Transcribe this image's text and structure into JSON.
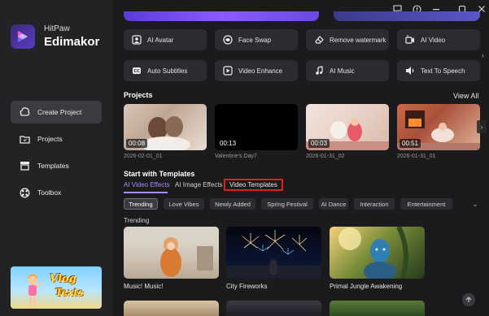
{
  "app": {
    "brand_small": "HitPaw",
    "brand_big": "Edimakor"
  },
  "sidebar": {
    "items": [
      {
        "label": "Create Project",
        "icon": "cloud-upload-icon",
        "active": true
      },
      {
        "label": "Projects",
        "icon": "folder-icon",
        "active": false
      },
      {
        "label": "Templates",
        "icon": "templates-icon",
        "active": false
      },
      {
        "label": "Toolbox",
        "icon": "toolbox-icon",
        "active": false
      }
    ],
    "banner": {
      "line1": "Vlog",
      "line2": "Texts"
    }
  },
  "window_controls": [
    "feedback-icon",
    "help-icon",
    "minimize-icon",
    "maximize-icon",
    "close-icon"
  ],
  "tools": [
    {
      "label": "AI Avatar",
      "icon": "avatar-icon"
    },
    {
      "label": "Face Swap",
      "icon": "face-swap-icon"
    },
    {
      "label": "Remove watermark",
      "icon": "eraser-icon"
    },
    {
      "label": "AI Video",
      "icon": "ai-video-icon"
    },
    {
      "label": "Auto Subtitles",
      "icon": "subtitles-icon"
    },
    {
      "label": "Video Enhance",
      "icon": "video-enhance-icon"
    },
    {
      "label": "AI Music",
      "icon": "music-icon"
    },
    {
      "label": "Text To Speech",
      "icon": "speaker-icon"
    }
  ],
  "projects": {
    "title": "Projects",
    "view_all": "View All",
    "items": [
      {
        "name": "2026-02-01_01",
        "duration": "00:08"
      },
      {
        "name": "Valentine's Day7",
        "duration": "00:13"
      },
      {
        "name": "2026-01-31_02",
        "duration": "00:03"
      },
      {
        "name": "2026-01-31_01",
        "duration": "00:51"
      }
    ]
  },
  "templates": {
    "title": "Start with Templates",
    "tabs": [
      "AI Video Effects",
      "AI Image Effects",
      "Video Templates"
    ],
    "active_tab": "AI Video Effects",
    "highlighted_tab": "Video Templates",
    "chips": [
      "Trending",
      "Love Vibes",
      "Newly Added",
      "Spring Festival",
      "AI Dance",
      "Interaction",
      "Entertainment"
    ],
    "active_chip": "Trending",
    "section_label": "Trending",
    "items": [
      {
        "name": "Music! Music!"
      },
      {
        "name": "City Fireworks"
      },
      {
        "name": "Primal Jungle Awakening"
      }
    ]
  },
  "colors": {
    "accent": "#a88bff",
    "highlight_border": "#e02020",
    "sidebar_bg": "#232326",
    "main_bg": "#1b1b1d"
  }
}
